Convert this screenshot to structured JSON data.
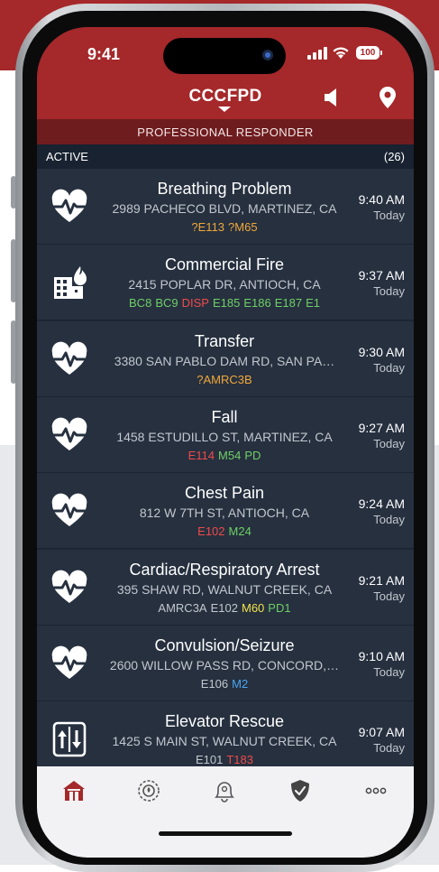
{
  "status_bar": {
    "time": "9:41",
    "battery": "100"
  },
  "header": {
    "title": "CCCFPD",
    "role": "PROFESSIONAL RESPONDER"
  },
  "section": {
    "label": "ACTIVE",
    "count": "(26)"
  },
  "colors": {
    "header_red": "#a5282a",
    "role_bar": "#6f1c1f",
    "list_bg": "#26303f",
    "unit_orange": "#f0a73a",
    "unit_green": "#6fcf66",
    "unit_red": "#ef4b4b",
    "unit_yellow": "#f2e24c",
    "unit_blue": "#4aa6f0",
    "unit_gray": "#c2c7cf",
    "tab_active": "#a5282a"
  },
  "incidents": [
    {
      "title": "Breathing Problem",
      "address": "2989 PACHECO BLVD, MARTINEZ, CA",
      "time": "9:40 AM",
      "day": "Today",
      "icon": "heart-pulse-icon",
      "units": [
        {
          "code": "?E113",
          "color": "#f0a73a"
        },
        {
          "code": "?M65",
          "color": "#f0a73a"
        }
      ]
    },
    {
      "title": "Commercial Fire",
      "address": "2415 POPLAR DR, ANTIOCH, CA",
      "time": "9:37 AM",
      "day": "Today",
      "icon": "building-fire-icon",
      "units": [
        {
          "code": "BC8",
          "color": "#6fcf66"
        },
        {
          "code": "BC9",
          "color": "#6fcf66"
        },
        {
          "code": "DISP",
          "color": "#ef4b4b"
        },
        {
          "code": "E185",
          "color": "#6fcf66"
        },
        {
          "code": "E186",
          "color": "#6fcf66"
        },
        {
          "code": "E187",
          "color": "#6fcf66"
        },
        {
          "code": "E1",
          "color": "#6fcf66"
        }
      ]
    },
    {
      "title": "Transfer",
      "address": "3380 SAN PABLO DAM RD, SAN PA…",
      "time": "9:30 AM",
      "day": "Today",
      "icon": "heart-pulse-icon",
      "units": [
        {
          "code": "?AMRC3B",
          "color": "#f0a73a"
        }
      ]
    },
    {
      "title": "Fall",
      "address": "1458 ESTUDILLO ST, MARTINEZ, CA",
      "time": "9:27 AM",
      "day": "Today",
      "icon": "heart-pulse-icon",
      "units": [
        {
          "code": "E114",
          "color": "#ef4b4b"
        },
        {
          "code": "M54",
          "color": "#6fcf66"
        },
        {
          "code": "PD",
          "color": "#6fcf66"
        }
      ]
    },
    {
      "title": "Chest Pain",
      "address": "812 W 7TH ST, ANTIOCH, CA",
      "time": "9:24 AM",
      "day": "Today",
      "icon": "heart-pulse-icon",
      "units": [
        {
          "code": "E102",
          "color": "#ef4b4b"
        },
        {
          "code": "M24",
          "color": "#6fcf66"
        }
      ]
    },
    {
      "title": "Cardiac/Respiratory Arrest",
      "address": "395 SHAW RD, WALNUT CREEK, CA",
      "time": "9:21 AM",
      "day": "Today",
      "icon": "heart-pulse-icon",
      "units": [
        {
          "code": "AMRC3A",
          "color": "#c2c7cf"
        },
        {
          "code": "E102",
          "color": "#c2c7cf"
        },
        {
          "code": "M60",
          "color": "#f2e24c"
        },
        {
          "code": "PD1",
          "color": "#6fcf66"
        }
      ]
    },
    {
      "title": "Convulsion/Seizure",
      "address": "2600 WILLOW PASS RD, CONCORD,…",
      "time": "9:10 AM",
      "day": "Today",
      "icon": "heart-pulse-icon",
      "units": [
        {
          "code": "E106",
          "color": "#c2c7cf"
        },
        {
          "code": "M2",
          "color": "#4aa6f0"
        }
      ]
    },
    {
      "title": "Elevator Rescue",
      "address": "1425 S MAIN ST, WALNUT CREEK, CA",
      "time": "9:07 AM",
      "day": "Today",
      "icon": "elevator-icon",
      "units": [
        {
          "code": "E101",
          "color": "#c2c7cf"
        },
        {
          "code": "T183",
          "color": "#ef4b4b"
        }
      ]
    }
  ],
  "tabs": [
    {
      "name": "home-tab",
      "icon": "firehouse-icon",
      "active": true
    },
    {
      "name": "stations-tab",
      "icon": "fire-badge-icon",
      "active": false
    },
    {
      "name": "alerts-tab",
      "icon": "alert-bell-icon",
      "active": false
    },
    {
      "name": "shield-tab",
      "icon": "shield-check-icon",
      "active": false
    },
    {
      "name": "more-tab",
      "icon": "more-dots-icon",
      "active": false
    }
  ]
}
